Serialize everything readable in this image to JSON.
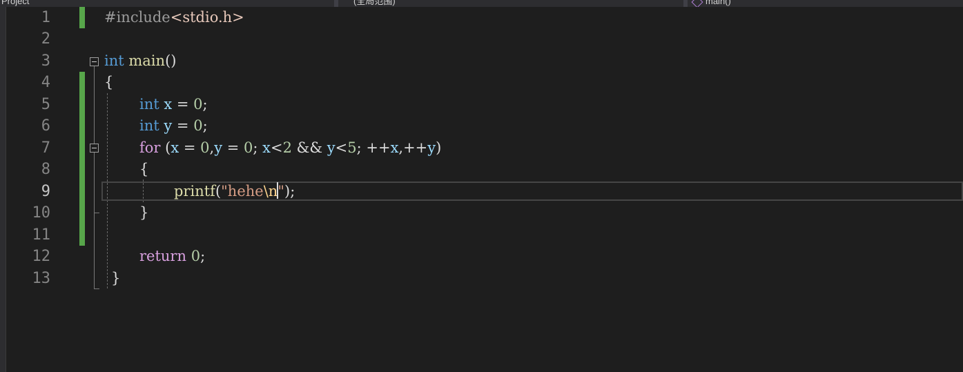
{
  "navbar": {
    "project": "Project",
    "scope": "(全局范围)",
    "member": "main()"
  },
  "editor": {
    "active_line": "9",
    "lines": [
      {
        "num": "1"
      },
      {
        "num": "2"
      },
      {
        "num": "3"
      },
      {
        "num": "4"
      },
      {
        "num": "5"
      },
      {
        "num": "6"
      },
      {
        "num": "7"
      },
      {
        "num": "8"
      },
      {
        "num": "9"
      },
      {
        "num": "10"
      },
      {
        "num": "11"
      },
      {
        "num": "12"
      },
      {
        "num": "13"
      }
    ],
    "code": {
      "l1_pp": "#include",
      "l1_header": "<stdio.h>",
      "l3_type": "int",
      "l3_name": "main",
      "l3_parens": "()",
      "l4": "{",
      "l5_type": "int",
      "l5_var": "x",
      "l5_eq": " = ",
      "l5_val": "0",
      "l5_end": ";",
      "l6_type": "int",
      "l6_var": "y",
      "l6_eq": " = ",
      "l6_val": "0",
      "l6_end": ";",
      "l7_kw": "for",
      "l7_p1": " (",
      "l7_x1": "x",
      "l7_a1": " = ",
      "l7_n1": "0",
      "l7_c1": ",",
      "l7_y1": "y",
      "l7_a2": " = ",
      "l7_n2": "0",
      "l7_s1": "; ",
      "l7_x2": "x",
      "l7_lt1": "<",
      "l7_n3": "2",
      "l7_and": " && ",
      "l7_y2": "y",
      "l7_lt2": "<",
      "l7_n4": "5",
      "l7_s2": "; ++",
      "l7_x3": "x",
      "l7_c2": ",++",
      "l7_y3": "y",
      "l7_p2": ")",
      "l8": "{",
      "l9_fn": "printf",
      "l9_open": "(",
      "l9_str": "\"hehe",
      "l9_esc1": "\\n",
      "l9_str_end": "\"",
      "l9_close": ");",
      "l10": "}",
      "l12_kw": "return",
      "l12_sp": " ",
      "l12_num": "0",
      "l12_end": ";",
      "l13": "}"
    }
  }
}
